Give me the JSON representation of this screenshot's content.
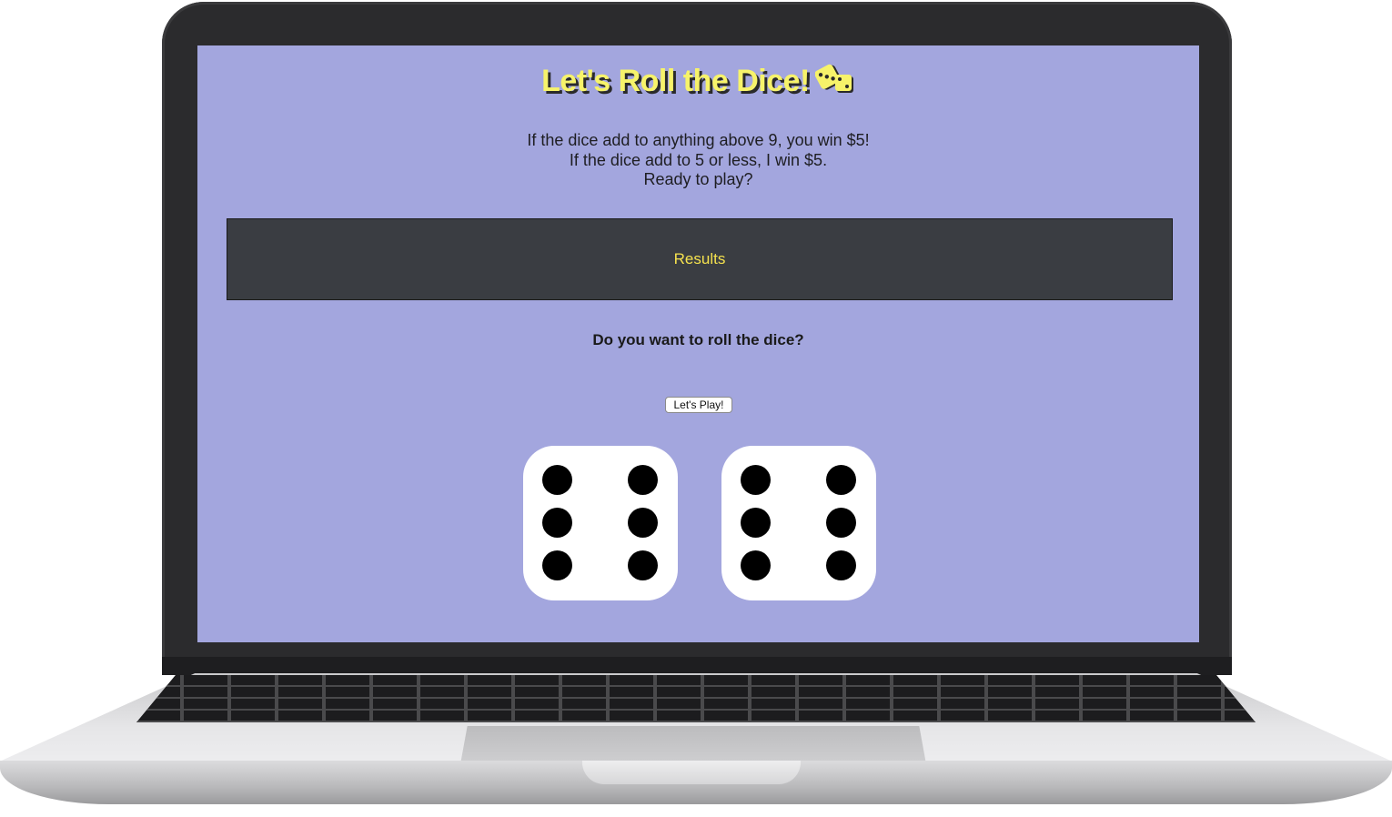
{
  "page": {
    "title": "Let's Roll the Dice!",
    "title_icon": "dice-icon",
    "rules": [
      "If the dice add to anything above 9, you win $5!",
      "If the dice add to 5 or less, I win $5.",
      "Ready to play?"
    ],
    "results_label": "Results",
    "question": "Do you want to roll the dice?",
    "play_button": "Let's Play!"
  },
  "dice": [
    {
      "value": 6,
      "icon": "die-six-icon"
    },
    {
      "value": 6,
      "icon": "die-six-icon"
    }
  ],
  "colors": {
    "screen_background": "#a3a6de",
    "title": "#f7f36a",
    "results_panel": "#3a3d42",
    "results_text": "#f5e24e"
  },
  "device": {
    "frame_icon": "laptop-icon"
  }
}
